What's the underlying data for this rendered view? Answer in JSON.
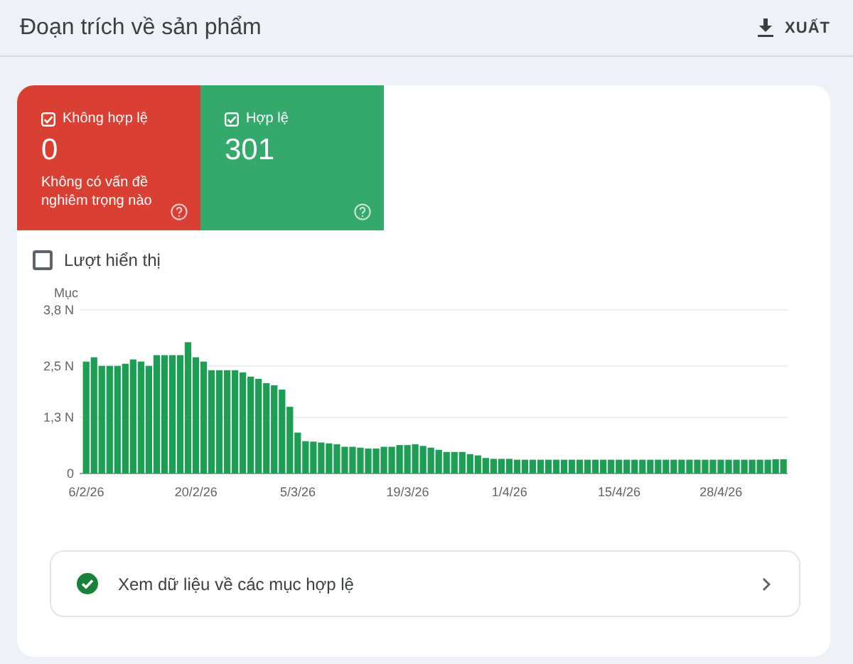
{
  "header": {
    "title": "Đoạn trích về sản phẩm",
    "export_label": "XUẤT"
  },
  "tiles": [
    {
      "kind": "error",
      "label": "Không hợp lệ",
      "checked": true,
      "value": "0",
      "note": "Không có vấn đề nghiêm trọng nào"
    },
    {
      "kind": "valid",
      "label": "Hợp lệ",
      "checked": true,
      "value": "301"
    }
  ],
  "impressions": {
    "label": "Lượt hiển thị",
    "checked": false
  },
  "chart_data": {
    "type": "bar",
    "ylabel": "Mục",
    "ylim": [
      0,
      3.8
    ],
    "yticks": [
      {
        "value": 0,
        "label": "0"
      },
      {
        "value": 1.3,
        "label": "1,3 N"
      },
      {
        "value": 2.5,
        "label": "2,5 N"
      },
      {
        "value": 3.8,
        "label": "3,8 N"
      }
    ],
    "categories": [
      "6/2/26",
      null,
      null,
      null,
      null,
      null,
      null,
      null,
      null,
      null,
      null,
      null,
      null,
      null,
      "20/2/26",
      null,
      null,
      null,
      null,
      null,
      null,
      null,
      null,
      null,
      null,
      null,
      null,
      "5/3/26",
      null,
      null,
      null,
      null,
      null,
      null,
      null,
      null,
      null,
      null,
      null,
      null,
      null,
      "19/3/26",
      null,
      null,
      null,
      null,
      null,
      null,
      null,
      null,
      null,
      null,
      null,
      null,
      "1/4/26",
      null,
      null,
      null,
      null,
      null,
      null,
      null,
      null,
      null,
      null,
      null,
      null,
      null,
      "15/4/26",
      null,
      null,
      null,
      null,
      null,
      null,
      null,
      null,
      null,
      null,
      null,
      null,
      "28/4/26",
      null,
      null,
      null,
      null,
      null,
      null,
      null,
      null
    ],
    "series": [
      {
        "color": "#1e9e55",
        "values": [
          2.6,
          2.7,
          2.5,
          2.5,
          2.5,
          2.55,
          2.65,
          2.6,
          2.5,
          2.75,
          2.75,
          2.75,
          2.75,
          3.05,
          2.7,
          2.6,
          2.4,
          2.4,
          2.4,
          2.4,
          2.35,
          2.25,
          2.2,
          2.1,
          2.05,
          1.95,
          1.55,
          0.95,
          0.75,
          0.74,
          0.72,
          0.7,
          0.68,
          0.62,
          0.62,
          0.6,
          0.58,
          0.58,
          0.62,
          0.62,
          0.66,
          0.66,
          0.68,
          0.64,
          0.6,
          0.55,
          0.5,
          0.5,
          0.5,
          0.45,
          0.42,
          0.36,
          0.34,
          0.34,
          0.34,
          0.32,
          0.32,
          0.32,
          0.32,
          0.32,
          0.32,
          0.32,
          0.32,
          0.32,
          0.32,
          0.32,
          0.32,
          0.32,
          0.32,
          0.32,
          0.32,
          0.32,
          0.32,
          0.32,
          0.32,
          0.32,
          0.32,
          0.32,
          0.32,
          0.32,
          0.32,
          0.32,
          0.32,
          0.32,
          0.32,
          0.32,
          0.32,
          0.32,
          0.33,
          0.33
        ]
      }
    ]
  },
  "details_link": {
    "label": "Xem dữ liệu về các mục hợp lệ"
  }
}
